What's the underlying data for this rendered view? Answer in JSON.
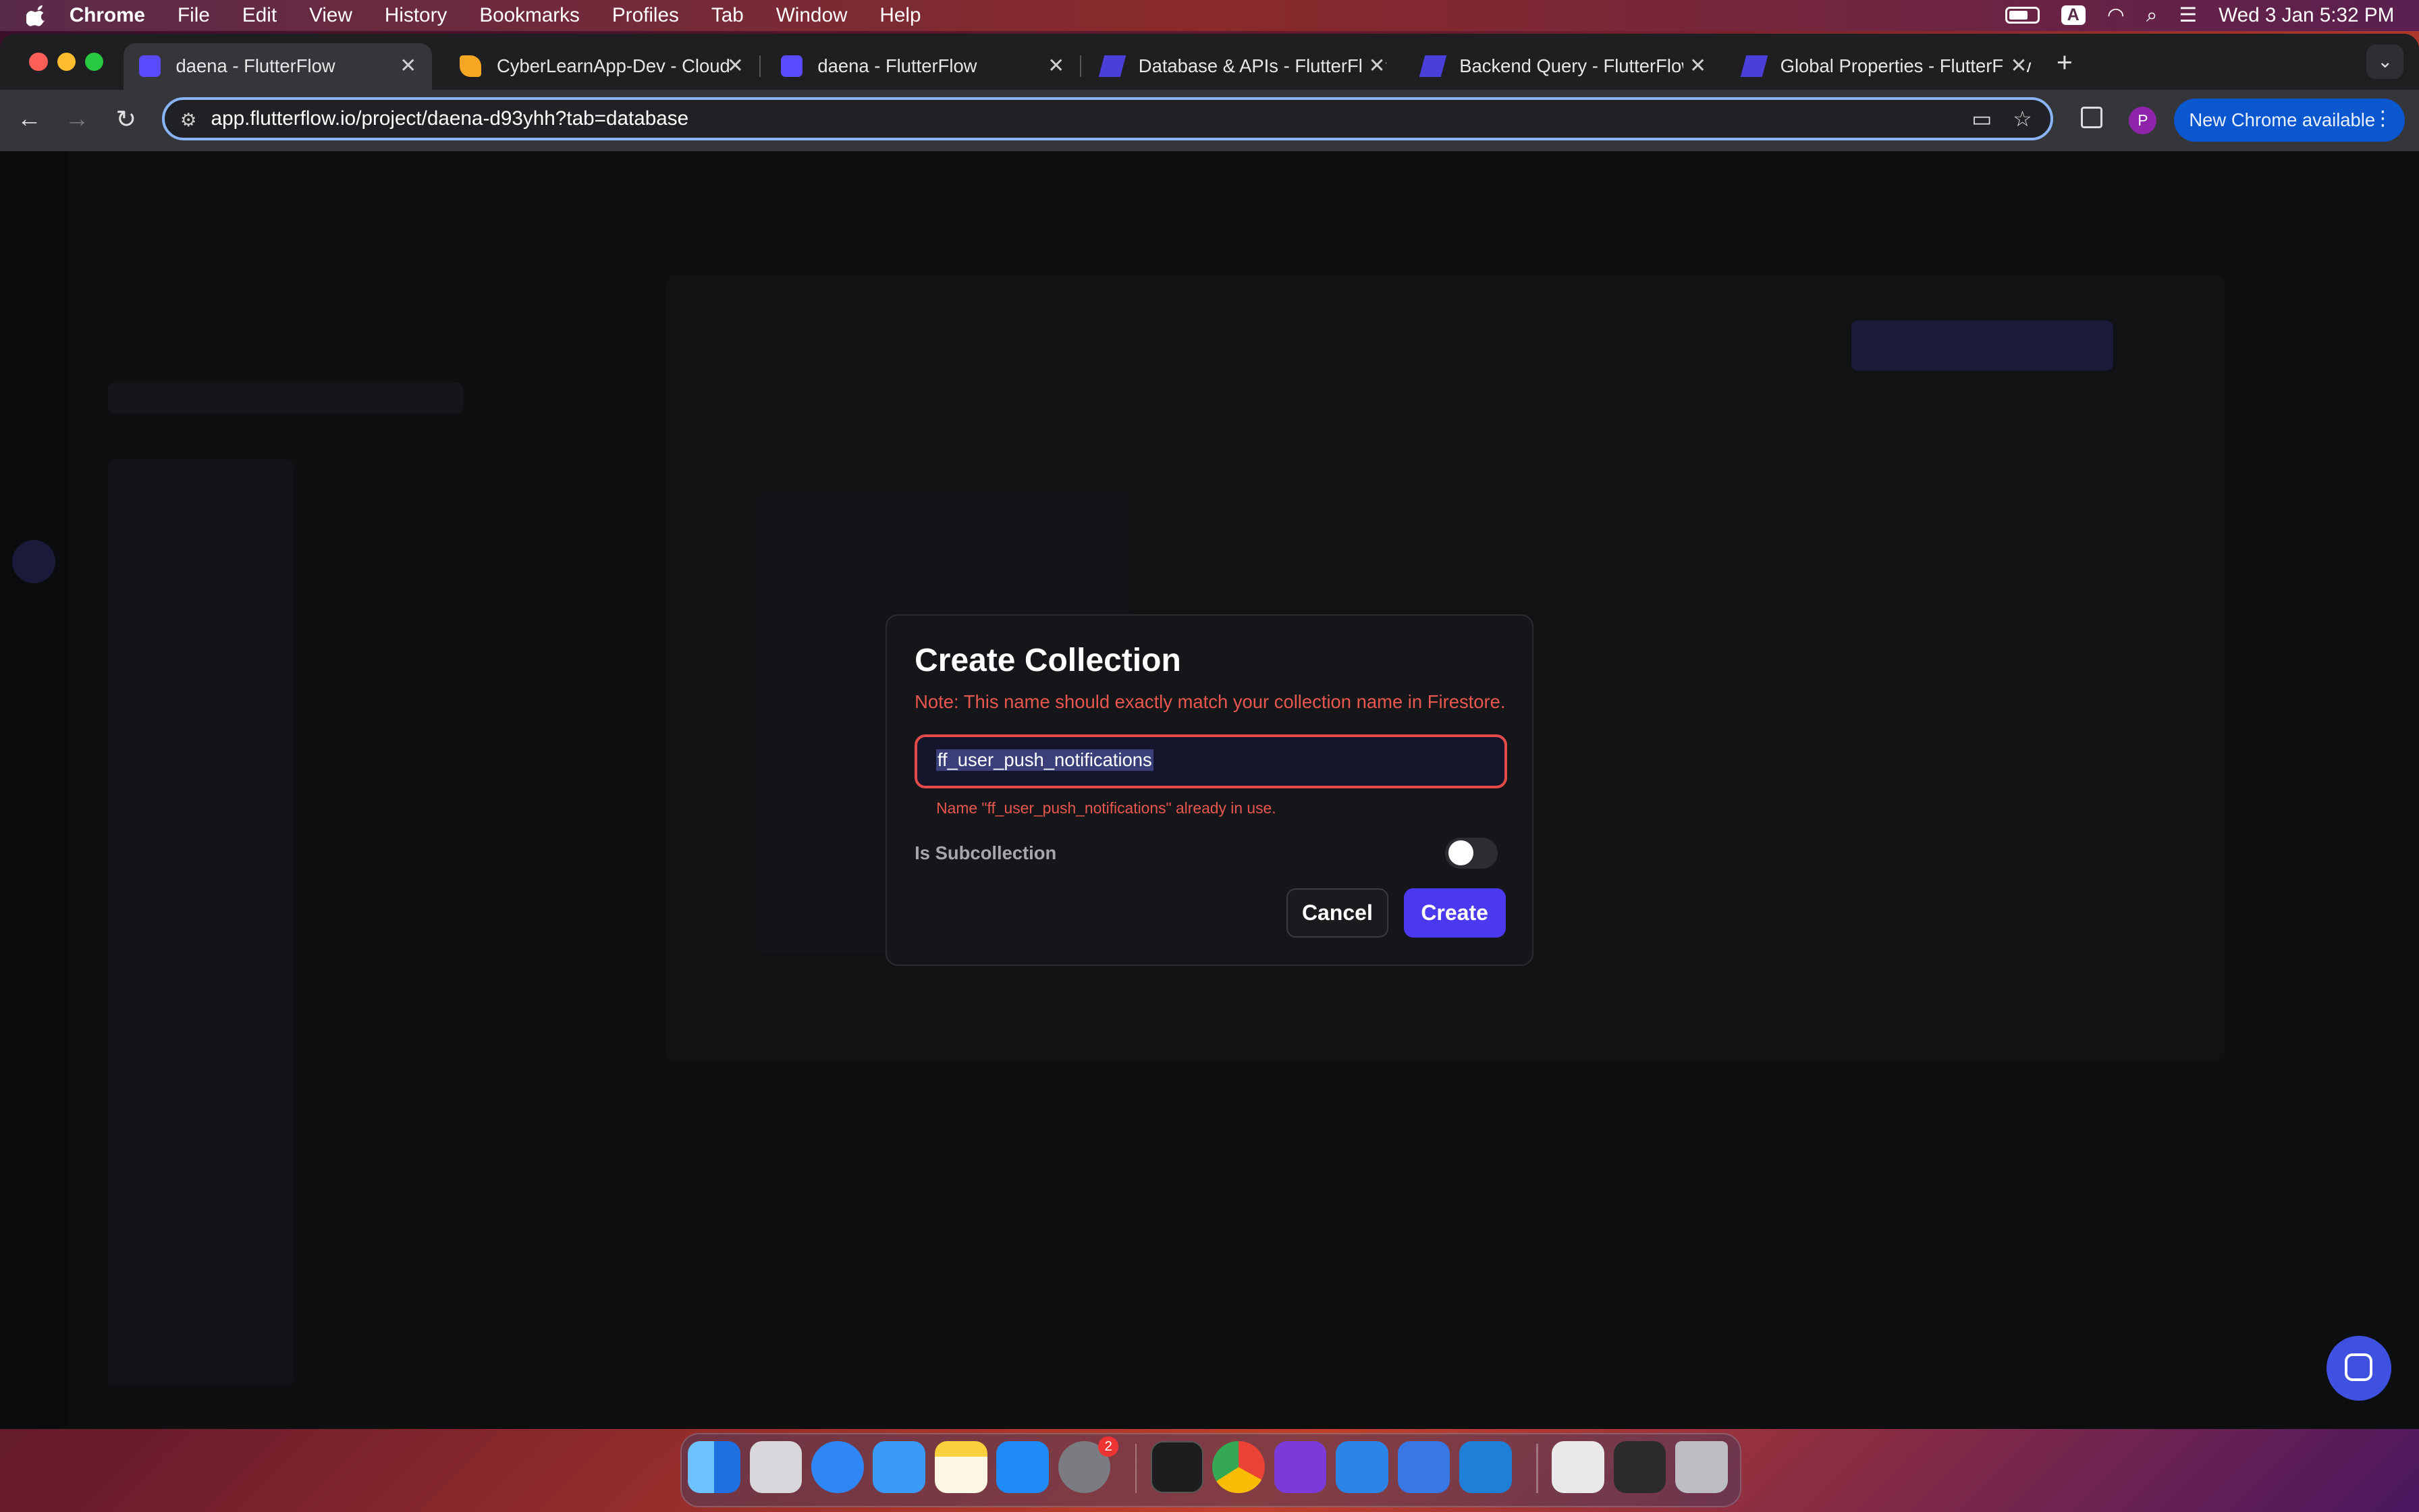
{
  "menubar": {
    "app_name": "Chrome",
    "menus": [
      "File",
      "Edit",
      "View",
      "History",
      "Bookmarks",
      "Profiles",
      "Tab",
      "Window",
      "Help"
    ],
    "input_source": "A",
    "clock": "Wed 3 Jan  5:32 PM"
  },
  "tabs": [
    {
      "title": "daena - FlutterFlow",
      "active": true
    },
    {
      "title": "CyberLearnApp-Dev - Cloud",
      "active": false
    },
    {
      "title": "daena - FlutterFlow",
      "active": false
    },
    {
      "title": "Database & APIs - FlutterFlow",
      "active": false
    },
    {
      "title": "Backend Query - FlutterFlow",
      "active": false
    },
    {
      "title": "Global Properties - FlutterFlow",
      "active": false
    }
  ],
  "toolbar": {
    "url": "app.flutterflow.io/project/daena-d93yhh?tab=database",
    "profile_initial": "P",
    "update_label": "New Chrome available"
  },
  "modal": {
    "title": "Create Collection",
    "note": "Note: This name should exactly match your collection name in Firestore.",
    "name_value": "ff_user_push_notifications",
    "error": "Name \"ff_user_push_notifications\" already in use.",
    "subcollection_label": "Is Subcollection",
    "subcollection_on": false,
    "cancel_label": "Cancel",
    "create_label": "Create"
  },
  "dock": {
    "apps": [
      "Finder",
      "Launchpad",
      "Safari",
      "Mail",
      "Notes",
      "App Store",
      "System Settings",
      "Terminal",
      "Chrome",
      "Feedback",
      "Xcode",
      "Instruments",
      "VS Code",
      "Preview",
      "Screenshot",
      "Trash"
    ],
    "settings_badge": "2"
  },
  "colors": {
    "accent": "#4b39ef",
    "error": "#e8574e",
    "chrome_blue": "#0b57d0"
  }
}
